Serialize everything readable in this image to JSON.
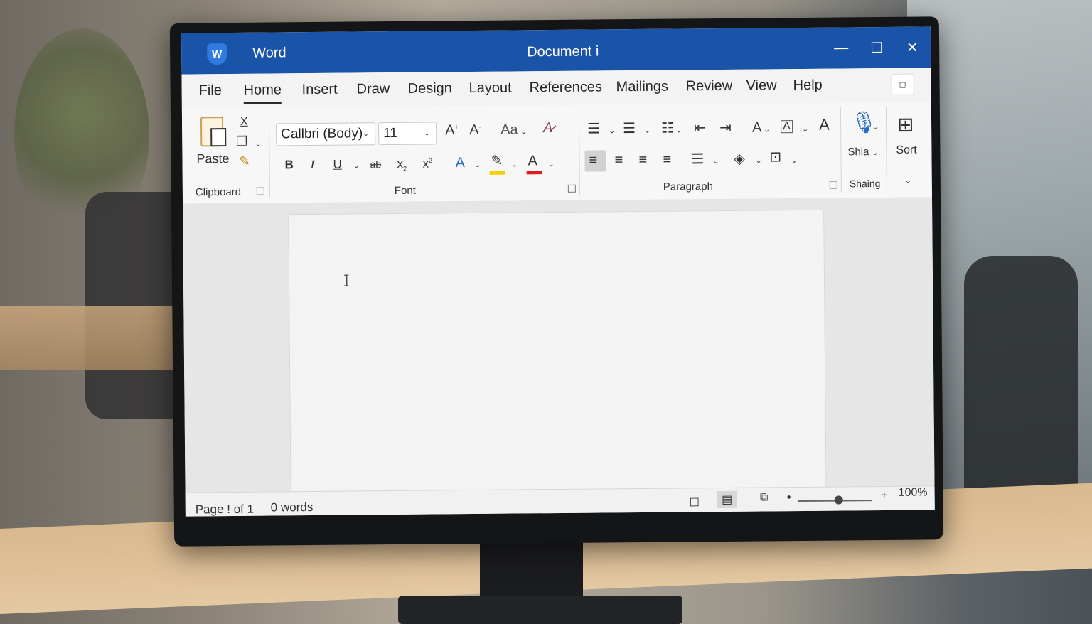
{
  "colors": {
    "title_bar": "#1a54a8",
    "accent": "#2f7be0",
    "highlight": "#f2d100",
    "font_color": "#e01b1b"
  },
  "titlebar": {
    "logo_letter": "W",
    "app_name": "Word",
    "doc_title": "Document i",
    "minimize": "—",
    "maximize": "☐",
    "close": "✕"
  },
  "menu": {
    "items": [
      "File",
      "Home",
      "Insert",
      "Draw",
      "Design",
      "Layout",
      "References",
      "Mailings",
      "Review",
      "View",
      "Help"
    ],
    "active": "Home",
    "ribbon_toggle": "◻"
  },
  "ribbon": {
    "clipboard": {
      "paste_label": "Paste",
      "group_label": "Clipboard",
      "cut": "X"
    },
    "font": {
      "font_name": "Callbri (Body)",
      "font_size": "11",
      "grow": "A",
      "shrink": "A",
      "change_case": "Aa",
      "bold": "B",
      "italic": "I",
      "underline": "U",
      "strike": "ab",
      "subscript": "x",
      "superscript": "x",
      "text_effects": "A",
      "font_color": "A",
      "group_label": "Font"
    },
    "paragraph": {
      "group_label": "Paragraph",
      "styles_a": "A"
    },
    "shaing": {
      "dictate_label": "Shia",
      "group_label": "Shaing"
    },
    "sort": {
      "label": "Sort"
    }
  },
  "status": {
    "page": "Page ! of 1",
    "words": "0 words",
    "zoom_minus": "•",
    "zoom_plus": "+",
    "zoom": "100%",
    "zoom_fraction": 0.55
  }
}
